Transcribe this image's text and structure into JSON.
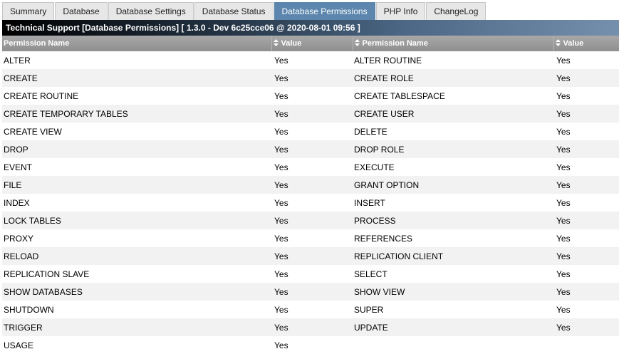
{
  "tabs": [
    {
      "label": "Summary",
      "active": false
    },
    {
      "label": "Database",
      "active": false
    },
    {
      "label": "Database Settings",
      "active": false
    },
    {
      "label": "Database Status",
      "active": false
    },
    {
      "label": "Database Permissions",
      "active": true
    },
    {
      "label": "PHP Info",
      "active": false
    },
    {
      "label": "ChangeLog",
      "active": false
    }
  ],
  "title": "Technical Support [Database Permissions] [ 1.3.0 - Dev 6c25cce06 @ 2020-08-01 09:56 ]",
  "table": {
    "headers": {
      "name1": "Permission Name",
      "value1": "Value",
      "name2": "Permission Name",
      "value2": "Value"
    },
    "sort_icon": "sort-updown-icon",
    "rows": [
      [
        "ALTER",
        "Yes",
        "ALTER ROUTINE",
        "Yes"
      ],
      [
        "CREATE",
        "Yes",
        "CREATE ROLE",
        "Yes"
      ],
      [
        "CREATE ROUTINE",
        "Yes",
        "CREATE TABLESPACE",
        "Yes"
      ],
      [
        "CREATE TEMPORARY TABLES",
        "Yes",
        "CREATE USER",
        "Yes"
      ],
      [
        "CREATE VIEW",
        "Yes",
        "DELETE",
        "Yes"
      ],
      [
        "DROP",
        "Yes",
        "DROP ROLE",
        "Yes"
      ],
      [
        "EVENT",
        "Yes",
        "EXECUTE",
        "Yes"
      ],
      [
        "FILE",
        "Yes",
        "GRANT OPTION",
        "Yes"
      ],
      [
        "INDEX",
        "Yes",
        "INSERT",
        "Yes"
      ],
      [
        "LOCK TABLES",
        "Yes",
        "PROCESS",
        "Yes"
      ],
      [
        "PROXY",
        "Yes",
        "REFERENCES",
        "Yes"
      ],
      [
        "RELOAD",
        "Yes",
        "REPLICATION CLIENT",
        "Yes"
      ],
      [
        "REPLICATION SLAVE",
        "Yes",
        "SELECT",
        "Yes"
      ],
      [
        "SHOW DATABASES",
        "Yes",
        "SHOW VIEW",
        "Yes"
      ],
      [
        "SHUTDOWN",
        "Yes",
        "SUPER",
        "Yes"
      ],
      [
        "TRIGGER",
        "Yes",
        "UPDATE",
        "Yes"
      ],
      [
        "USAGE",
        "Yes",
        "",
        ""
      ]
    ]
  },
  "colors": {
    "active_tab": "#5c86ad",
    "header_bg": "#999999",
    "row_alt": "#f2f2f2"
  }
}
